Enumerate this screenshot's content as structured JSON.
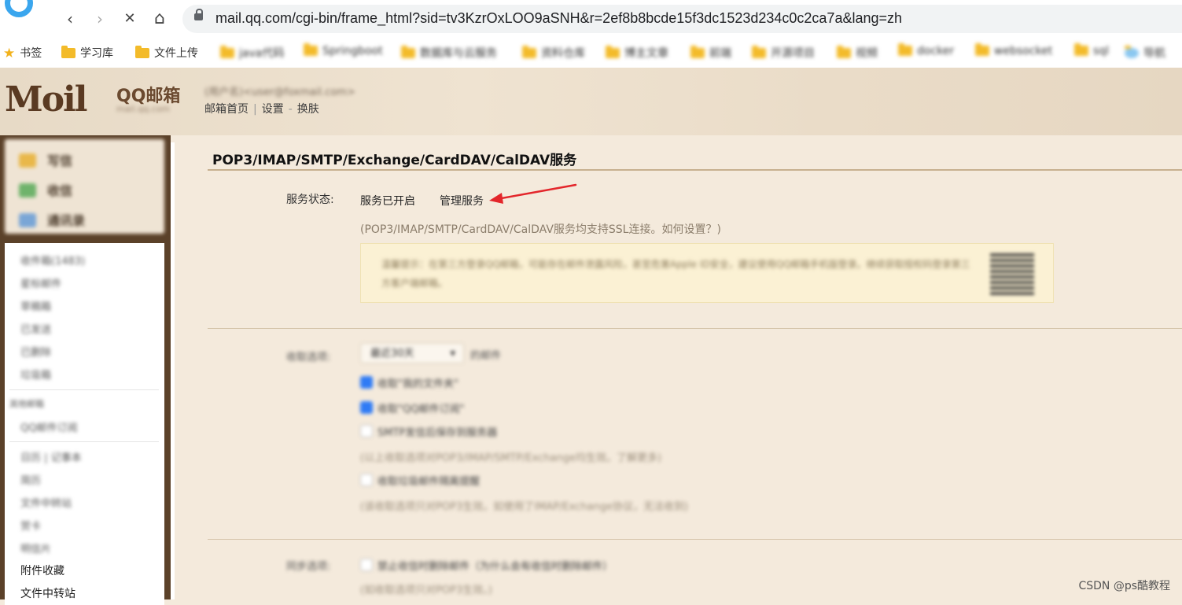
{
  "browser": {
    "url": "mail.qq.com/cgi-bin/frame_html?sid=tv3KzrOxLOO9aSNH&r=2ef8b8bcde15f3dc1523d234c0c2ca7a&lang=zh",
    "back_icon": "‹",
    "forward_icon": "›",
    "stop_icon": "✕",
    "home_icon": "⌂",
    "bookmarks": [
      {
        "label": "书签",
        "icon": "star-icon"
      },
      {
        "label": "学习库",
        "icon": "folder-icon"
      },
      {
        "label": "文件上传",
        "icon": "folder-icon"
      },
      {
        "label": "java代码",
        "icon": "folder-icon"
      },
      {
        "label": "Springboot",
        "icon": "folder-icon"
      },
      {
        "label": "数据库与云服务",
        "icon": "folder-icon"
      },
      {
        "label": "资料仓库",
        "icon": "folder-icon"
      },
      {
        "label": "博主文章",
        "icon": "folder-icon"
      },
      {
        "label": "前端",
        "icon": "folder-icon"
      },
      {
        "label": "开源项目",
        "icon": "folder-icon"
      },
      {
        "label": "视频",
        "icon": "folder-icon"
      },
      {
        "label": "docker",
        "icon": "folder-icon"
      },
      {
        "label": "websocket",
        "icon": "folder-icon"
      },
      {
        "label": "sql",
        "icon": "folder-icon"
      },
      {
        "label": "导航",
        "icon": "globe-icon"
      }
    ]
  },
  "header": {
    "logo_text": "Moil",
    "logo_qq": "QQ邮箱",
    "logo_sub": "mail.qq.com",
    "user_line": "(用户名)<user@foxmail.com>",
    "links": [
      "邮箱首页",
      "设置",
      "换肤"
    ],
    "sep1": "|",
    "sep2": "-"
  },
  "sidebar": {
    "top_buttons": [
      "写信",
      "收信",
      "通讯录"
    ],
    "items_blurred": [
      "收件箱(1483)",
      "星标邮件",
      "草稿箱",
      "已发送",
      "已删除",
      "垃圾箱",
      "其他邮箱",
      "QQ邮件订阅",
      "日历 | 记事本",
      "简历",
      "文件中转站",
      "贺卡",
      "明信片"
    ],
    "items_clear": [
      "附件收藏",
      "文件中转站"
    ]
  },
  "main": {
    "title": "POP3/IMAP/SMTP/Exchange/CardDAV/CalDAV服务",
    "status_label": "服务状态:",
    "status_value": "服务已开启",
    "manage_link": "管理服务",
    "ssl_note": "(POP3/IMAP/SMTP/CardDAV/CalDAV服务均支持SSL连接。如何设置？)",
    "warning": "温馨提示：在第三方登录QQ邮箱，可能存在邮件泄露风险，甚至危害Apple ID安全，建议使用QQ邮箱手机版登录。继续获取授权码登录第三方客户端邮箱。",
    "recv_label": "收取选项:",
    "recv_select": "最近30天",
    "recv_after": "的邮件",
    "options": [
      {
        "label": "收取\"我的文件夹\"",
        "checked": true
      },
      {
        "label": "收取\"QQ邮件订阅\"",
        "checked": true
      },
      {
        "label": "SMTP发信后保存到服务器",
        "checked": false
      }
    ],
    "option_note1": "(以上收取选项对POP3/IMAP/SMTP/Exchange均生效。了解更多)",
    "option4": "收取垃圾邮件隔离提醒",
    "option_note2": "(该收取选项只对POP3生效。如使用了IMAP/Exchange协议，无法收到)",
    "send_label": "同步选项:",
    "send_option": "禁止收信时删除邮件（为什么会有收信时删除邮件）",
    "send_note": "(如收取选项只对POP3生效。)"
  },
  "watermark": "CSDN @ps酷教程"
}
